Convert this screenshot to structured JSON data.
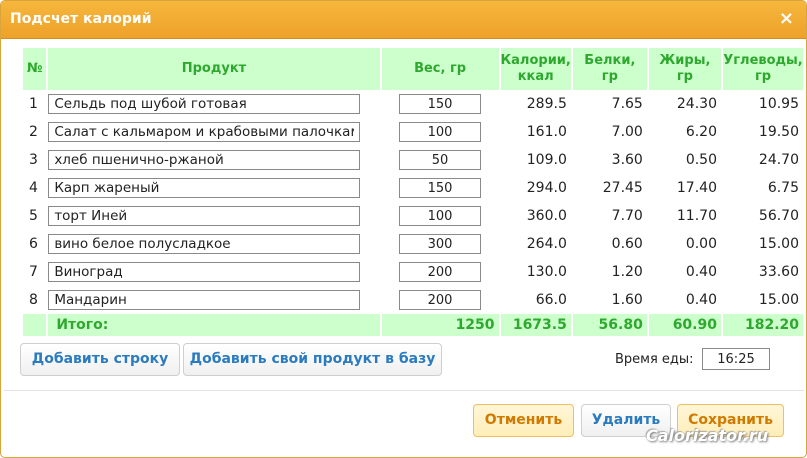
{
  "window": {
    "title": "Подсчет калорий",
    "close_icon": "×"
  },
  "table": {
    "headers": {
      "num": "№",
      "product": "Продукт",
      "weight": "Вес, гр",
      "calories_line1": "Калории,",
      "calories_line2": "ккал",
      "protein_line1": "Белки,",
      "protein_line2": "гр",
      "fat_line1": "Жиры,",
      "fat_line2": "гр",
      "carbs_line1": "Углеводы,",
      "carbs_line2": "гр"
    },
    "rows": [
      {
        "num": "1",
        "product": "Сельдь под шубой готовая",
        "weight": "150",
        "calories": "289.5",
        "protein": "7.65",
        "fat": "24.30",
        "carbs": "10.95"
      },
      {
        "num": "2",
        "product": "Салат с кальмаром и крабовыми палочками",
        "weight": "100",
        "calories": "161.0",
        "protein": "7.00",
        "fat": "6.20",
        "carbs": "19.50"
      },
      {
        "num": "3",
        "product": "хлеб пшенично-ржаной",
        "weight": "50",
        "calories": "109.0",
        "protein": "3.60",
        "fat": "0.50",
        "carbs": "24.70"
      },
      {
        "num": "4",
        "product": "Карп жареный",
        "weight": "150",
        "calories": "294.0",
        "protein": "27.45",
        "fat": "17.40",
        "carbs": "6.75"
      },
      {
        "num": "5",
        "product": "торт Иней",
        "weight": "100",
        "calories": "360.0",
        "protein": "7.70",
        "fat": "11.70",
        "carbs": "56.70"
      },
      {
        "num": "6",
        "product": "вино белое полусладкое",
        "weight": "300",
        "calories": "264.0",
        "protein": "0.60",
        "fat": "0.00",
        "carbs": "15.00"
      },
      {
        "num": "7",
        "product": "Виноград",
        "weight": "200",
        "calories": "130.0",
        "protein": "1.20",
        "fat": "0.40",
        "carbs": "33.60"
      },
      {
        "num": "8",
        "product": "Мандарин",
        "weight": "200",
        "calories": "66.0",
        "protein": "1.60",
        "fat": "0.40",
        "carbs": "15.00"
      }
    ],
    "total": {
      "label": "Итого:",
      "weight": "1250",
      "calories": "1673.5",
      "protein": "56.80",
      "fat": "60.90",
      "carbs": "182.20"
    }
  },
  "actions": {
    "add_row": "Добавить строку",
    "add_product": "Добавить свой продукт в базу",
    "meal_time_label": "Время еды:",
    "meal_time_value": "16:25"
  },
  "footer": {
    "cancel": "Отменить",
    "delete": "Удалить",
    "save": "Сохранить"
  },
  "watermark": "Calorizator.ru",
  "colors": {
    "titlebar": "#f6b73c",
    "header_bg": "#ccffcc",
    "header_text": "#2ea82e",
    "button_text": "#2b7bbf",
    "orange_button_text": "#d07a00"
  }
}
